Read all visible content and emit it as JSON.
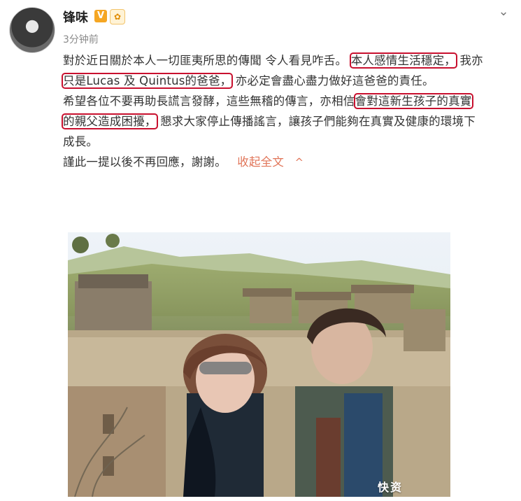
{
  "post": {
    "author": "锋味",
    "v_badge": "V",
    "fans_badge": "✿",
    "time": "3分钟前",
    "text": {
      "l1a": "對於近日關於本人一切匪夷所思的傳聞 令人看見咋舌。",
      "l1b": "本人感情生活穩定，",
      "l1c": "我亦",
      "l2a": "只是Lucas 及 Quintus的爸爸，",
      "l2b": "亦必定會盡心盡力做好這爸爸的責任。",
      "l3a": "希望各位不要再助長謊言發酵，這些無稽的傳言，亦相信",
      "l3b": "會對這新生孩子的真實",
      "l4a": "的親父造成困擾，",
      "l4b": "懇求大家停止傳播謠言，讓孩子們能夠在真實及健康的環境下",
      "l5": "成長。",
      "l6": "謹此一提以後不再回應，謝謝。"
    },
    "collapse_label": "收起全文",
    "collapse_icon": "^"
  },
  "watermark": "快资",
  "colors": {
    "highlight": "#c8102e",
    "link": "#e1765a"
  }
}
